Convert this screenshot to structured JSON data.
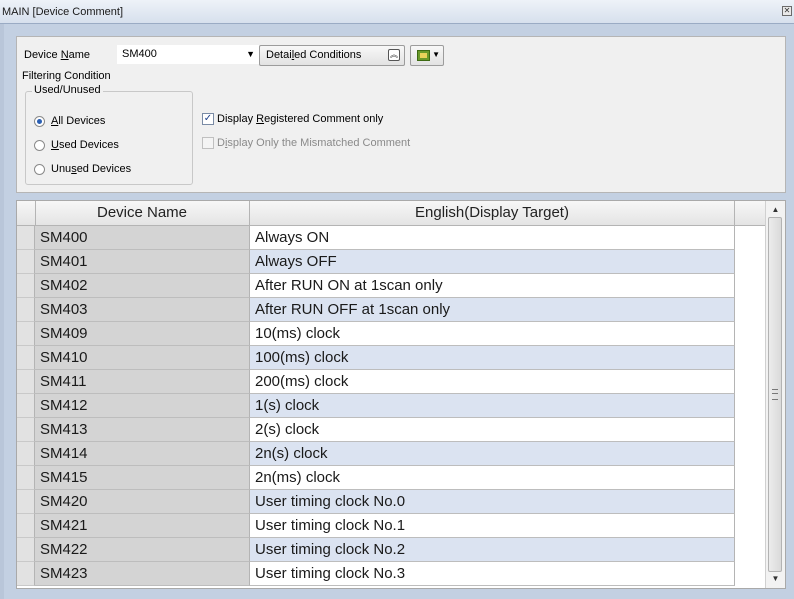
{
  "window": {
    "title": "MAIN [Device Comment]"
  },
  "toolbar": {
    "device_name_label_pre": "Device ",
    "device_name_label_key": "N",
    "device_name_label_post": "ame",
    "device_name_value": "SM400",
    "detailed_conditions_pre": "Detai",
    "detailed_conditions_key": "l",
    "detailed_conditions_post": "ed Conditions"
  },
  "filter": {
    "title": "Filtering Condition",
    "used_unused": {
      "legend": "Used/Unused",
      "options": [
        {
          "pre": "",
          "key": "A",
          "post": "ll Devices",
          "selected": true
        },
        {
          "pre": "",
          "key": "U",
          "post": "sed Devices",
          "selected": false
        },
        {
          "pre": "Unu",
          "key": "s",
          "post": "ed Devices",
          "selected": false
        }
      ]
    },
    "display_registered": {
      "pre": "Display ",
      "key": "R",
      "post": "egistered Comment only",
      "checked": true,
      "enabled": true
    },
    "display_mismatched": {
      "pre": "D",
      "key": "i",
      "post": "splay Only the Mismatched Comment",
      "checked": false,
      "enabled": false
    }
  },
  "grid": {
    "columns": [
      "Device Name",
      "English(Display Target)"
    ],
    "rows": [
      {
        "device": "SM400",
        "comment": "Always ON"
      },
      {
        "device": "SM401",
        "comment": "Always OFF"
      },
      {
        "device": "SM402",
        "comment": "After RUN ON at 1scan only"
      },
      {
        "device": "SM403",
        "comment": "After RUN OFF at 1scan only"
      },
      {
        "device": "SM409",
        "comment": "10(ms) clock"
      },
      {
        "device": "SM410",
        "comment": "100(ms) clock"
      },
      {
        "device": "SM411",
        "comment": "200(ms) clock"
      },
      {
        "device": "SM412",
        "comment": "1(s) clock"
      },
      {
        "device": "SM413",
        "comment": "2(s) clock"
      },
      {
        "device": "SM414",
        "comment": "2n(s) clock"
      },
      {
        "device": "SM415",
        "comment": "2n(ms) clock"
      },
      {
        "device": "SM420",
        "comment": "User timing clock No.0"
      },
      {
        "device": "SM421",
        "comment": "User timing clock No.1"
      },
      {
        "device": "SM422",
        "comment": "User timing clock No.2"
      },
      {
        "device": "SM423",
        "comment": "User timing clock No.3"
      }
    ]
  },
  "icons": {
    "close": "close-icon",
    "dropdown": "chevron-down-icon",
    "collapse": "double-chevron-up-icon",
    "filter": "filter-icon"
  }
}
